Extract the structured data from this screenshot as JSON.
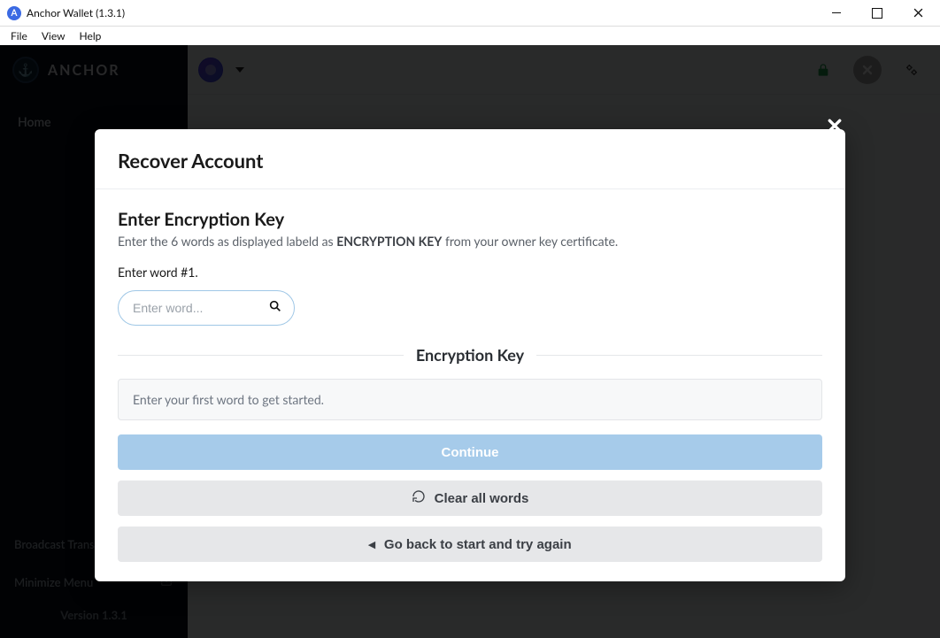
{
  "window": {
    "title": "Anchor Wallet (1.3.1)"
  },
  "menubar": {
    "file": "File",
    "view": "View",
    "help": "Help"
  },
  "brand": {
    "name": "ANCHOR"
  },
  "sidebar": {
    "home": "Home",
    "broadcast": "Broadcast Transaction",
    "minimize": "Minimize Menu",
    "version": "Version 1.3.1"
  },
  "modal": {
    "title": "Recover Account",
    "section_title": "Enter Encryption Key",
    "section_desc_pre": "Enter the 6 words as displayed labeld as ",
    "section_desc_strong": "ENCRYPTION KEY",
    "section_desc_post": " from your owner key certificate.",
    "prompt": "Enter word #1.",
    "input_placeholder": "Enter word...",
    "divider_label": "Encryption Key",
    "info": "Enter your first word to get started.",
    "continue": "Continue",
    "clear": "Clear all words",
    "goback": "Go back to start and try again"
  }
}
